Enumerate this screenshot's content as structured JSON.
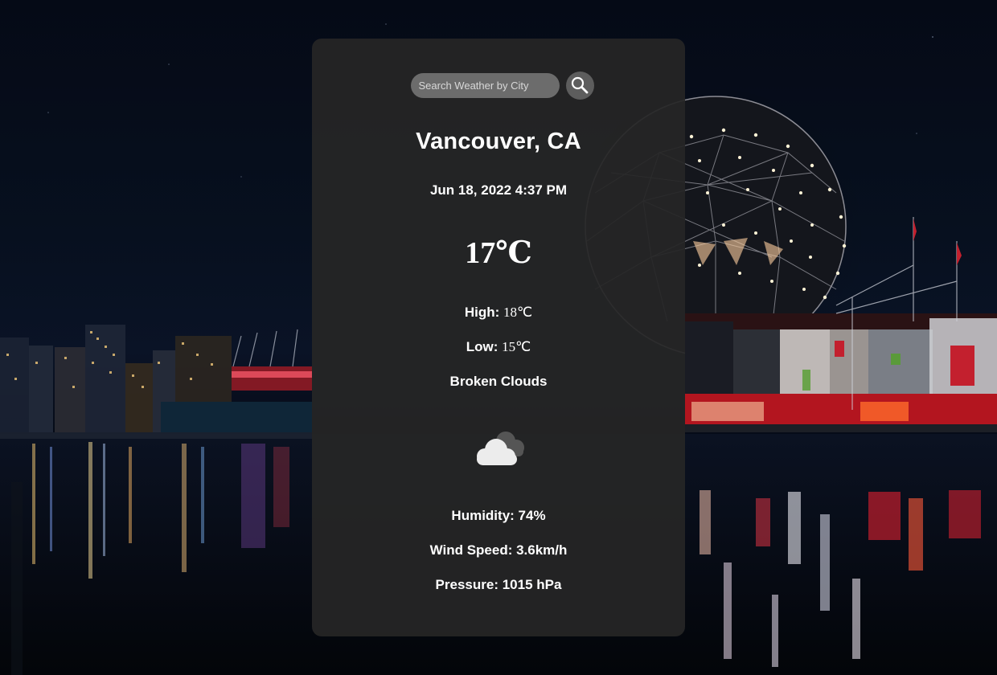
{
  "search": {
    "placeholder": "Search Weather by City"
  },
  "weather": {
    "city": "Vancouver, CA",
    "datetime": "Jun 18, 2022 4:37 PM",
    "temperature": "17℃",
    "high_label": "High: ",
    "high_value": "18℃",
    "low_label": "Low: ",
    "low_value": "15℃",
    "description": "Broken Clouds",
    "icon": "broken-clouds-icon",
    "humidity": "Humidity: 74%",
    "wind_speed": "Wind Speed: 3.6km/h",
    "pressure": "Pressure: 1015 hPa"
  },
  "colors": {
    "card_background": "#262626",
    "search_field": "#6c6c6c",
    "search_button": "#5d5d5d",
    "text": "#ffffff"
  }
}
